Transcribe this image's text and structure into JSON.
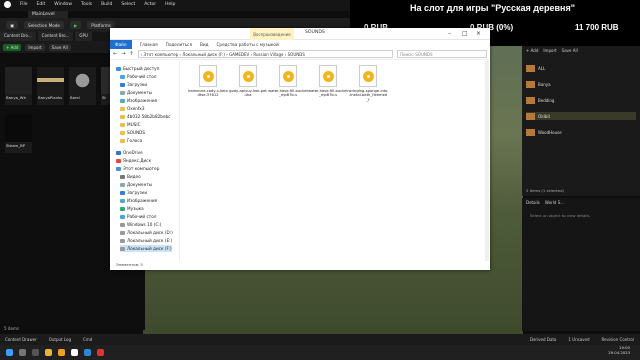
{
  "ue": {
    "menu": [
      "File",
      "Edit",
      "Window",
      "Tools",
      "Build",
      "Select",
      "Actor",
      "Help"
    ],
    "level_tab": "MainLevel",
    "toolbar": [
      "Selection Mode",
      "Platforms"
    ],
    "cb_tabs": [
      "Content Bro...",
      "Content Bro...",
      "GPU"
    ],
    "cb_buttons": [
      "+ Add",
      "Import",
      "Save All"
    ],
    "assets": [
      {
        "name": "Banya_Wh"
      },
      {
        "name": "BanyaPlanks"
      },
      {
        "name": "Barel"
      },
      {
        "name": "St"
      },
      {
        "name": "Steam_BP"
      }
    ],
    "outliner": {
      "buttons": [
        "+ Add",
        "Import",
        "Save All"
      ],
      "folders": [
        {
          "name": "ALL",
          "sub": "Folder"
        },
        {
          "name": "Banya",
          "sub": "Folder"
        },
        {
          "name": "Bedding",
          "sub": "Folder"
        },
        {
          "name": "Oldbit",
          "sub": "Folder"
        },
        {
          "name": "WoodHouse",
          "sub": "Folder"
        }
      ],
      "count": "5 items (1 selected)"
    },
    "details": {
      "tabs": [
        "Details",
        "World S..."
      ],
      "placeholder": "Select an object to view details."
    },
    "status": [
      "Content Drawer",
      "Output Log",
      "Cmd",
      "Derived Data",
      "1 Unsaved",
      "Revision Control"
    ],
    "items_count": "5 items"
  },
  "stream": {
    "title": "На слот для игры \"Русская деревня\"",
    "left": "0 RUB",
    "mid": "0 RUB (0%)",
    "right": "11 700 RUB",
    "progress": 0
  },
  "explorer": {
    "ribbon_ctx": "Воспроизведение",
    "title": "SOUNDS",
    "tabs": [
      "Файл",
      "Главная",
      "Поделиться",
      "Вид",
      "Средства работы с музыкой"
    ],
    "path": "›  Этот компьютер  ›  Локальный диск (F:)  ›  GAMEDEV  ›  Russian Village  ›  SOUNDS",
    "search": "Поиск: SOUNDS",
    "nav": [
      {
        "label": "Быстрый доступ",
        "icon": "star"
      },
      {
        "label": "Рабочий стол",
        "icon": "desktop"
      },
      {
        "label": "Загрузки",
        "icon": "download"
      },
      {
        "label": "Документы",
        "icon": "doc"
      },
      {
        "label": "Изображения",
        "icon": "image"
      },
      {
        "label": "Oxenfx3",
        "icon": "folder"
      },
      {
        "label": "4b032.58b2b82bebc",
        "icon": "folder"
      },
      {
        "label": "MUSIC",
        "icon": "folder"
      },
      {
        "label": "SOUNDS",
        "icon": "folder"
      },
      {
        "label": "Голоса",
        "icon": "folder"
      },
      {
        "label": "OneDrive",
        "icon": "cloud"
      },
      {
        "label": "Яндекс.Диск",
        "icon": "cloud"
      },
      {
        "label": "Этот компьютер",
        "icon": "pc"
      },
      {
        "label": "Видео",
        "icon": "video"
      },
      {
        "label": "Документы",
        "icon": "doc"
      },
      {
        "label": "Загрузки",
        "icon": "download"
      },
      {
        "label": "Изображения",
        "icon": "image"
      },
      {
        "label": "Музыка",
        "icon": "music"
      },
      {
        "label": "Рабочий стол",
        "icon": "desktop"
      },
      {
        "label": "Windows 10 (C:)",
        "icon": "drive"
      },
      {
        "label": "Локальный диск (D:)",
        "icon": "drive"
      },
      {
        "label": "Локальный диск (E:)",
        "icon": "drive"
      },
      {
        "label": "Локальный диск (F:)",
        "icon": "drive"
      }
    ],
    "files": [
      "kamenne-cody-c-kolodtse-37612",
      "gody-aplyuy-kok-petuha",
      "water-hose-fill-bucket_mp67b-s",
      "water-hose-fill-bucket_mp67b-s",
      "wringing-sponge-into-metal-bath_fleemed_f"
    ],
    "status": "Элементов: 5"
  },
  "taskbar": {
    "time": "19:00",
    "date": "29.04.2023"
  }
}
